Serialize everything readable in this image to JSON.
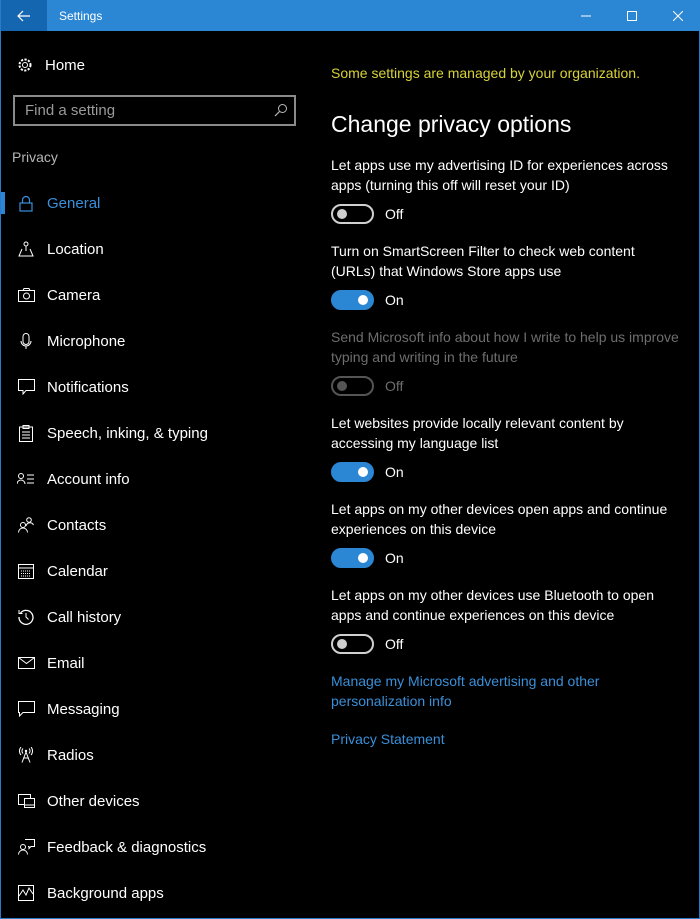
{
  "window": {
    "title": "Settings",
    "accent_color": "#2b86d3",
    "controls": [
      "minimize",
      "maximize",
      "close"
    ]
  },
  "sidebar": {
    "home_label": "Home",
    "search_placeholder": "Find a setting",
    "section_title": "Privacy",
    "items": [
      {
        "label": "General",
        "icon": "lock-icon",
        "active": true
      },
      {
        "label": "Location",
        "icon": "location-icon"
      },
      {
        "label": "Camera",
        "icon": "camera-icon"
      },
      {
        "label": "Microphone",
        "icon": "microphone-icon"
      },
      {
        "label": "Notifications",
        "icon": "notifications-icon"
      },
      {
        "label": "Speech, inking, & typing",
        "icon": "clipboard-icon"
      },
      {
        "label": "Account info",
        "icon": "account-info-icon"
      },
      {
        "label": "Contacts",
        "icon": "contacts-icon"
      },
      {
        "label": "Calendar",
        "icon": "calendar-icon"
      },
      {
        "label": "Call history",
        "icon": "history-icon"
      },
      {
        "label": "Email",
        "icon": "email-icon"
      },
      {
        "label": "Messaging",
        "icon": "messaging-icon"
      },
      {
        "label": "Radios",
        "icon": "radio-tower-icon"
      },
      {
        "label": "Other devices",
        "icon": "devices-icon"
      },
      {
        "label": "Feedback & diagnostics",
        "icon": "feedback-icon"
      },
      {
        "label": "Background apps",
        "icon": "background-apps-icon"
      }
    ]
  },
  "main": {
    "org_notice": "Some settings are managed by your organization.",
    "heading": "Change privacy options",
    "settings": [
      {
        "description": "Let apps use my advertising ID for experiences across apps (turning this off will reset your ID)",
        "state": "Off",
        "on": false,
        "disabled": false
      },
      {
        "description": "Turn on SmartScreen Filter to check web content (URLs) that Windows Store apps use",
        "state": "On",
        "on": true,
        "disabled": false
      },
      {
        "description": "Send Microsoft info about how I write to help us improve typing and writing in the future",
        "state": "Off",
        "on": false,
        "disabled": true
      },
      {
        "description": "Let websites provide locally relevant content by accessing my language list",
        "state": "On",
        "on": true,
        "disabled": false
      },
      {
        "description": "Let apps on my other devices open apps and continue experiences on this device",
        "state": "On",
        "on": true,
        "disabled": false
      },
      {
        "description": "Let apps on my other devices use Bluetooth to open apps and continue experiences on this device",
        "state": "Off",
        "on": false,
        "disabled": false
      }
    ],
    "links": [
      {
        "label": "Manage my Microsoft advertising and other personalization info"
      },
      {
        "label": "Privacy Statement"
      }
    ]
  }
}
